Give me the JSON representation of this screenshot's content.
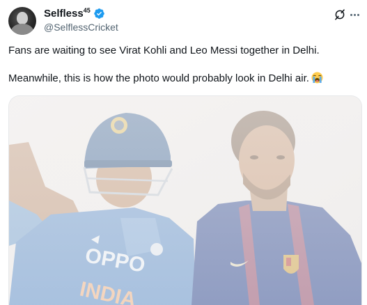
{
  "author": {
    "display_name": "Selfless",
    "display_name_sup": "45",
    "handle": "@SelflessCricket",
    "verified": true,
    "verified_icon": "verified-badge-icon",
    "verified_color": "#1d9bf0"
  },
  "header_icons": {
    "grok": "grok-icon",
    "more": "more-options-icon"
  },
  "tweet": {
    "line1": "Fans are waiting to see Virat Kohli and Leo Messi together in Delhi.",
    "line2": "Meanwhile, this is how the photo would probably look in Delhi air.",
    "emoji": "loudly-crying-face-icon"
  },
  "media": {
    "description_icon": "hazy-photo",
    "left_jersey_texts": [
      "OPPO",
      "INDIA"
    ]
  },
  "colors": {
    "text_primary": "#0f1419",
    "text_secondary": "#536471",
    "accent": "#1d9bf0"
  }
}
